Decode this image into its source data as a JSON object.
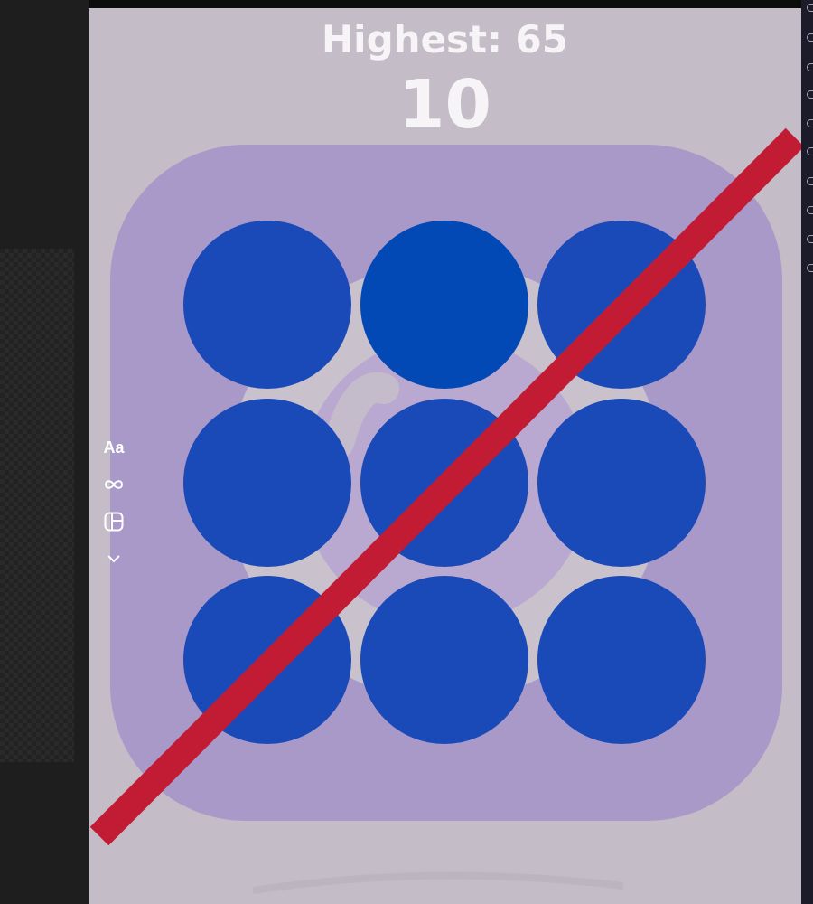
{
  "game": {
    "highest_label": "Highest: 65",
    "score": "10",
    "grid": {
      "rows": 3,
      "cols": 3,
      "circle_color": "#1a4ab8",
      "highlight_color": "#0249b6",
      "highlighted_index": 1
    },
    "slash_color": "#c21c34",
    "board_color": "#a999c9",
    "background_color": "#c4bcc6"
  },
  "tools": {
    "text_label": "Aa",
    "infinity_icon": "infinity-icon",
    "layout_icon": "layout-icon",
    "chevron_icon": "chevron-down-icon"
  }
}
